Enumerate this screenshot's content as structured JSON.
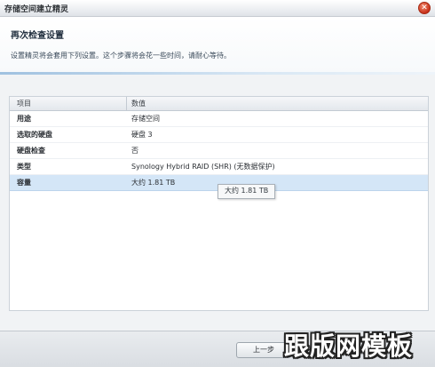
{
  "window": {
    "title": "存储空间建立精灵",
    "close_icon": "✕"
  },
  "header": {
    "heading": "再次检查设置",
    "description": "设置精灵将会套用下列设置。这个步骤将会花一些时间，请耐心等待。"
  },
  "table": {
    "columns": [
      "项目",
      "数值"
    ],
    "rows": [
      {
        "key": "用途",
        "value": "存储空间"
      },
      {
        "key": "选取的硬盘",
        "value": "硬盘 3"
      },
      {
        "key": "硬盘检查",
        "value": "否"
      },
      {
        "key": "类型",
        "value": "Synology Hybrid RAID (SHR) (无数据保护)"
      },
      {
        "key": "容量",
        "value": "大约 1.81 TB"
      }
    ],
    "selected_row": 4
  },
  "tooltip": {
    "text": "大约 1.81 TB"
  },
  "footer": {
    "prev_label": "上一步"
  },
  "watermark": {
    "text": "跟版网模板"
  },
  "colors": {
    "close_button": "#c9311a",
    "selected_row": "#d4e6f7",
    "header_accent": "#9fc1e0"
  }
}
